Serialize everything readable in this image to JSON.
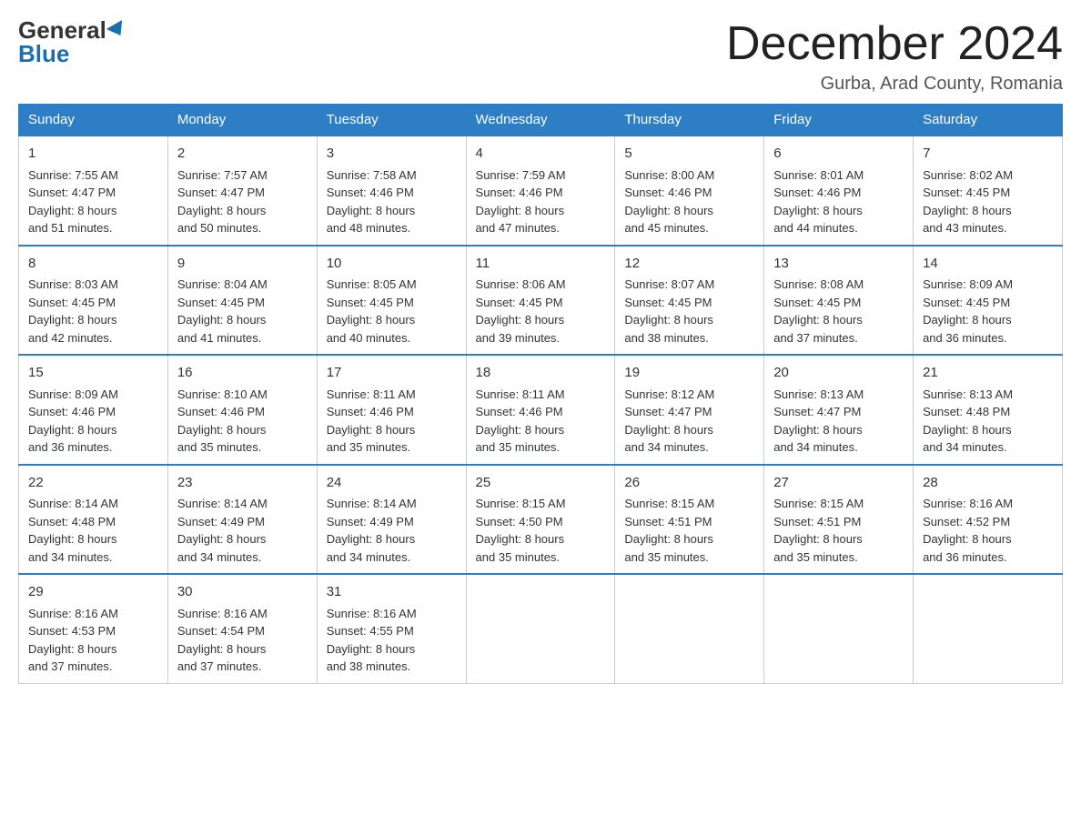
{
  "logo": {
    "general": "General",
    "blue": "Blue"
  },
  "title": "December 2024",
  "location": "Gurba, Arad County, Romania",
  "days_of_week": [
    "Sunday",
    "Monday",
    "Tuesday",
    "Wednesday",
    "Thursday",
    "Friday",
    "Saturday"
  ],
  "weeks": [
    [
      {
        "day": "1",
        "sunrise": "7:55 AM",
        "sunset": "4:47 PM",
        "daylight": "8 hours and 51 minutes."
      },
      {
        "day": "2",
        "sunrise": "7:57 AM",
        "sunset": "4:47 PM",
        "daylight": "8 hours and 50 minutes."
      },
      {
        "day": "3",
        "sunrise": "7:58 AM",
        "sunset": "4:46 PM",
        "daylight": "8 hours and 48 minutes."
      },
      {
        "day": "4",
        "sunrise": "7:59 AM",
        "sunset": "4:46 PM",
        "daylight": "8 hours and 47 minutes."
      },
      {
        "day": "5",
        "sunrise": "8:00 AM",
        "sunset": "4:46 PM",
        "daylight": "8 hours and 45 minutes."
      },
      {
        "day": "6",
        "sunrise": "8:01 AM",
        "sunset": "4:46 PM",
        "daylight": "8 hours and 44 minutes."
      },
      {
        "day": "7",
        "sunrise": "8:02 AM",
        "sunset": "4:45 PM",
        "daylight": "8 hours and 43 minutes."
      }
    ],
    [
      {
        "day": "8",
        "sunrise": "8:03 AM",
        "sunset": "4:45 PM",
        "daylight": "8 hours and 42 minutes."
      },
      {
        "day": "9",
        "sunrise": "8:04 AM",
        "sunset": "4:45 PM",
        "daylight": "8 hours and 41 minutes."
      },
      {
        "day": "10",
        "sunrise": "8:05 AM",
        "sunset": "4:45 PM",
        "daylight": "8 hours and 40 minutes."
      },
      {
        "day": "11",
        "sunrise": "8:06 AM",
        "sunset": "4:45 PM",
        "daylight": "8 hours and 39 minutes."
      },
      {
        "day": "12",
        "sunrise": "8:07 AM",
        "sunset": "4:45 PM",
        "daylight": "8 hours and 38 minutes."
      },
      {
        "day": "13",
        "sunrise": "8:08 AM",
        "sunset": "4:45 PM",
        "daylight": "8 hours and 37 minutes."
      },
      {
        "day": "14",
        "sunrise": "8:09 AM",
        "sunset": "4:45 PM",
        "daylight": "8 hours and 36 minutes."
      }
    ],
    [
      {
        "day": "15",
        "sunrise": "8:09 AM",
        "sunset": "4:46 PM",
        "daylight": "8 hours and 36 minutes."
      },
      {
        "day": "16",
        "sunrise": "8:10 AM",
        "sunset": "4:46 PM",
        "daylight": "8 hours and 35 minutes."
      },
      {
        "day": "17",
        "sunrise": "8:11 AM",
        "sunset": "4:46 PM",
        "daylight": "8 hours and 35 minutes."
      },
      {
        "day": "18",
        "sunrise": "8:11 AM",
        "sunset": "4:46 PM",
        "daylight": "8 hours and 35 minutes."
      },
      {
        "day": "19",
        "sunrise": "8:12 AM",
        "sunset": "4:47 PM",
        "daylight": "8 hours and 34 minutes."
      },
      {
        "day": "20",
        "sunrise": "8:13 AM",
        "sunset": "4:47 PM",
        "daylight": "8 hours and 34 minutes."
      },
      {
        "day": "21",
        "sunrise": "8:13 AM",
        "sunset": "4:48 PM",
        "daylight": "8 hours and 34 minutes."
      }
    ],
    [
      {
        "day": "22",
        "sunrise": "8:14 AM",
        "sunset": "4:48 PM",
        "daylight": "8 hours and 34 minutes."
      },
      {
        "day": "23",
        "sunrise": "8:14 AM",
        "sunset": "4:49 PM",
        "daylight": "8 hours and 34 minutes."
      },
      {
        "day": "24",
        "sunrise": "8:14 AM",
        "sunset": "4:49 PM",
        "daylight": "8 hours and 34 minutes."
      },
      {
        "day": "25",
        "sunrise": "8:15 AM",
        "sunset": "4:50 PM",
        "daylight": "8 hours and 35 minutes."
      },
      {
        "day": "26",
        "sunrise": "8:15 AM",
        "sunset": "4:51 PM",
        "daylight": "8 hours and 35 minutes."
      },
      {
        "day": "27",
        "sunrise": "8:15 AM",
        "sunset": "4:51 PM",
        "daylight": "8 hours and 35 minutes."
      },
      {
        "day": "28",
        "sunrise": "8:16 AM",
        "sunset": "4:52 PM",
        "daylight": "8 hours and 36 minutes."
      }
    ],
    [
      {
        "day": "29",
        "sunrise": "8:16 AM",
        "sunset": "4:53 PM",
        "daylight": "8 hours and 37 minutes."
      },
      {
        "day": "30",
        "sunrise": "8:16 AM",
        "sunset": "4:54 PM",
        "daylight": "8 hours and 37 minutes."
      },
      {
        "day": "31",
        "sunrise": "8:16 AM",
        "sunset": "4:55 PM",
        "daylight": "8 hours and 38 minutes."
      },
      null,
      null,
      null,
      null
    ]
  ],
  "labels": {
    "sunrise": "Sunrise:",
    "sunset": "Sunset:",
    "daylight": "Daylight:"
  }
}
